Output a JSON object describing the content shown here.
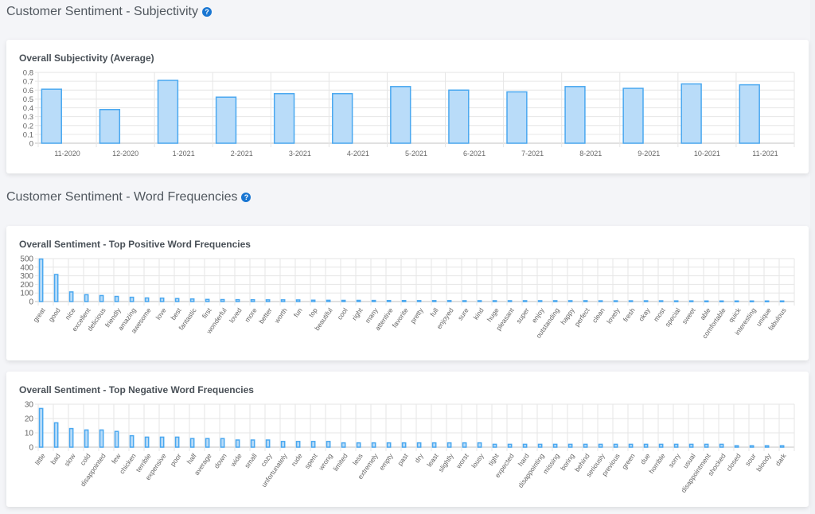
{
  "sections": {
    "subjectivity": {
      "title": "Customer Sentiment - Subjectivity",
      "help": "?"
    },
    "word_frequencies": {
      "title": "Customer Sentiment - Word Frequencies",
      "help": "?"
    }
  },
  "colors": {
    "bar_fill": "#b9dcf9",
    "bar_stroke": "#4aa8f0",
    "grid": "#e6e6e6",
    "axis_text": "#666666",
    "help_icon": "#1976d2"
  },
  "chart_data": [
    {
      "id": "subjectivity",
      "type": "bar",
      "title": "Overall Subjectivity (Average)",
      "xlabel": "",
      "ylabel": "",
      "ylim": [
        0,
        0.8
      ],
      "yticks": [
        "0",
        "0.1",
        "0.2",
        "0.3",
        "0.4",
        "0.5",
        "0.6",
        "0.7",
        "0.8"
      ],
      "ytick_values": [
        0,
        0.1,
        0.2,
        0.3,
        0.4,
        0.5,
        0.6,
        0.7,
        0.8
      ],
      "grid": true,
      "legend": "none",
      "label_rotation": 0,
      "categories": [
        "11-2020",
        "12-2020",
        "1-2021",
        "2-2021",
        "3-2021",
        "4-2021",
        "5-2021",
        "6-2021",
        "7-2021",
        "8-2021",
        "9-2021",
        "10-2021",
        "11-2021"
      ],
      "values": [
        0.61,
        0.38,
        0.71,
        0.52,
        0.56,
        0.56,
        0.64,
        0.6,
        0.58,
        0.64,
        0.62,
        0.67,
        0.66
      ]
    },
    {
      "id": "positive",
      "type": "bar",
      "title": "Overall Sentiment - Top Positive Word Frequencies",
      "xlabel": "",
      "ylabel": "",
      "ylim": [
        0,
        500
      ],
      "yticks": [
        "0",
        "100",
        "200",
        "300",
        "400",
        "500"
      ],
      "ytick_values": [
        0,
        100,
        200,
        300,
        400,
        500
      ],
      "grid": true,
      "legend": "none",
      "label_rotation": -55,
      "categories": [
        "great",
        "good",
        "nice",
        "excellent",
        "delicious",
        "friendly",
        "amazing",
        "awesome",
        "love",
        "best",
        "fantastic",
        "first",
        "wonderful",
        "loved",
        "more",
        "better",
        "worth",
        "fun",
        "top",
        "beautiful",
        "cool",
        "right",
        "many",
        "attentive",
        "favorite",
        "pretty",
        "full",
        "enjoyed",
        "sure",
        "kind",
        "huge",
        "pleasant",
        "super",
        "enjoy",
        "outstanding",
        "happy",
        "perfect",
        "clean",
        "lovely",
        "fresh",
        "okay",
        "most",
        "special",
        "sweet",
        "able",
        "comfortable",
        "quick",
        "interesting",
        "unique",
        "fabulous"
      ],
      "values": [
        495,
        315,
        112,
        80,
        70,
        60,
        50,
        42,
        40,
        35,
        30,
        25,
        23,
        22,
        21,
        20,
        20,
        19,
        16,
        15,
        14,
        14,
        13,
        12,
        12,
        11,
        11,
        11,
        10,
        10,
        10,
        10,
        10,
        10,
        10,
        10,
        10,
        9,
        9,
        9,
        9,
        9,
        8,
        8,
        7,
        7,
        7,
        7,
        7,
        7
      ]
    },
    {
      "id": "negative",
      "type": "bar",
      "title": "Overall Sentiment - Top Negative Word Frequencies",
      "xlabel": "",
      "ylabel": "",
      "ylim": [
        0,
        30
      ],
      "yticks": [
        "0",
        "10",
        "20",
        "30"
      ],
      "ytick_values": [
        0,
        10,
        20,
        30
      ],
      "grid": true,
      "legend": "none",
      "label_rotation": -55,
      "categories": [
        "little",
        "bad",
        "slow",
        "cold",
        "disappointed",
        "few",
        "chicken",
        "terrible",
        "expensive",
        "poor",
        "half",
        "average",
        "down",
        "wide",
        "small",
        "cozy",
        "unfortunately",
        "rude",
        "spent",
        "wrong",
        "limited",
        "less",
        "extremely",
        "empty",
        "past",
        "dry",
        "least",
        "slightly",
        "worst",
        "lousy",
        "tight",
        "expected",
        "hard",
        "disappointing",
        "missing",
        "boring",
        "behind",
        "seriously",
        "previous",
        "green",
        "due",
        "horrible",
        "sorry",
        "usual",
        "disappointment",
        "shocked",
        "closed",
        "sour",
        "bloody",
        "dark"
      ],
      "values": [
        27,
        17,
        13,
        12,
        12,
        11,
        8,
        7,
        7,
        7,
        6,
        6,
        6,
        5,
        5,
        5,
        4,
        4,
        4,
        4,
        3,
        3,
        3,
        3,
        3,
        3,
        3,
        3,
        3,
        3,
        2,
        2,
        2,
        2,
        2,
        2,
        2,
        2,
        2,
        2,
        2,
        2,
        2,
        2,
        2,
        2,
        1,
        1,
        1,
        1
      ]
    }
  ]
}
